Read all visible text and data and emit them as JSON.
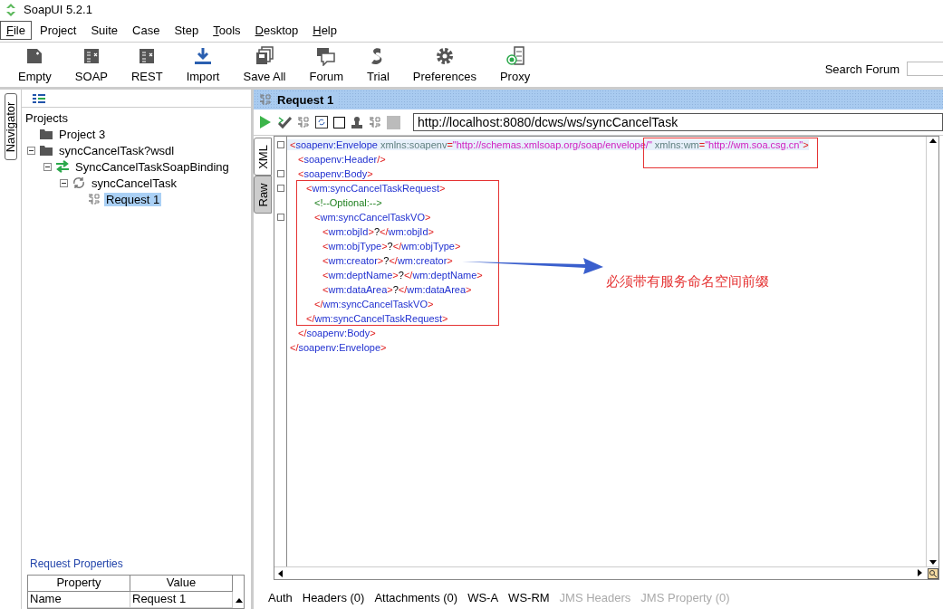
{
  "window": {
    "title": "SoapUI 5.2.1"
  },
  "menu": [
    {
      "label": "File",
      "mnemonic": true,
      "selected": true
    },
    {
      "label": "Project",
      "mnemonic": false,
      "selected": false
    },
    {
      "label": "Suite",
      "mnemonic": false,
      "selected": false
    },
    {
      "label": "Case",
      "mnemonic": false,
      "selected": false
    },
    {
      "label": "Step",
      "mnemonic": false,
      "selected": false
    },
    {
      "label": "Tools",
      "mnemonic": true,
      "selected": false
    },
    {
      "label": "Desktop",
      "mnemonic": true,
      "selected": false
    },
    {
      "label": "Help",
      "mnemonic": true,
      "selected": false
    }
  ],
  "toolbar": [
    {
      "label": "Empty",
      "kind": "empty"
    },
    {
      "label": "SOAP",
      "kind": "soap"
    },
    {
      "label": "REST",
      "kind": "rest"
    },
    {
      "label": "Import",
      "kind": "import"
    },
    {
      "label": "Save All",
      "kind": "save"
    },
    {
      "label": "Forum",
      "kind": "forum"
    },
    {
      "label": "Trial",
      "kind": "trial"
    },
    {
      "label": "Preferences",
      "kind": "prefs"
    },
    {
      "label": "Proxy",
      "kind": "proxy"
    }
  ],
  "search": {
    "label": "Search Forum"
  },
  "navigator": {
    "tab": "Navigator",
    "root": "Projects",
    "tree": [
      {
        "label": "Project 3",
        "kind": "project",
        "selected": false
      },
      {
        "label": "syncCancelTask?wsdl",
        "kind": "project",
        "expanded": true,
        "selected": false,
        "children": [
          {
            "label": "SyncCancelTaskSoapBinding",
            "kind": "binding",
            "expanded": true,
            "selected": false,
            "children": [
              {
                "label": "syncCancelTask",
                "kind": "operation",
                "expanded": true,
                "selected": false,
                "children": [
                  {
                    "label": "Request 1",
                    "kind": "request",
                    "selected": true
                  }
                ]
              }
            ]
          }
        ]
      }
    ]
  },
  "properties": {
    "title": "Request Properties",
    "columns": [
      "Property",
      "Value"
    ],
    "rows": [
      [
        "Name",
        "Request 1"
      ]
    ]
  },
  "request": {
    "title": "Request 1",
    "url": "http://localhost:8080/dcws/ws/syncCancelTask",
    "side_tabs": [
      {
        "label": "XML",
        "selected": true
      },
      {
        "label": "Raw",
        "selected": false
      }
    ],
    "xml": [
      {
        "current": true,
        "tokens": [
          {
            "kind": "punct",
            "text": "<"
          },
          {
            "kind": "tag",
            "text": "soapenv:Envelope"
          },
          {
            "kind": "attr",
            "text": " xmlns:soapenv"
          },
          {
            "kind": "punct",
            "text": "="
          },
          {
            "kind": "value",
            "text": "\"http://schemas.xmlsoap.org/soap/envelope/\""
          },
          {
            "kind": "attr",
            "text": " xmlns:wm"
          },
          {
            "kind": "punct",
            "text": "="
          },
          {
            "kind": "value",
            "text": "\"http://wm.soa.csg.cn\""
          },
          {
            "kind": "punct",
            "text": ">"
          }
        ],
        "children": [
          {
            "current": false,
            "tokens": [
              {
                "kind": "punct",
                "text": "<"
              },
              {
                "kind": "tag",
                "text": "soapenv:Header"
              },
              {
                "kind": "punct",
                "text": "/>"
              }
            ]
          },
          {
            "current": false,
            "tokens": [
              {
                "kind": "punct",
                "text": "<"
              },
              {
                "kind": "tag",
                "text": "soapenv:Body"
              },
              {
                "kind": "punct",
                "text": ">"
              }
            ],
            "children": [
              {
                "current": false,
                "tokens": [
                  {
                    "kind": "punct",
                    "text": "<"
                  },
                  {
                    "kind": "tag",
                    "text": "wm:syncCancelTaskRequest"
                  },
                  {
                    "kind": "punct",
                    "text": ">"
                  }
                ],
                "children": [
                  {
                    "current": false,
                    "tokens": [
                      {
                        "kind": "comment",
                        "text": "<!--Optional:-->"
                      }
                    ]
                  },
                  {
                    "current": false,
                    "tokens": [
                      {
                        "kind": "punct",
                        "text": "<"
                      },
                      {
                        "kind": "tag",
                        "text": "wm:syncCancelTaskVO"
                      },
                      {
                        "kind": "punct",
                        "text": ">"
                      }
                    ],
                    "children": [
                      {
                        "current": false,
                        "tokens": [
                          {
                            "kind": "punct",
                            "text": "<"
                          },
                          {
                            "kind": "tag",
                            "text": "wm:objId"
                          },
                          {
                            "kind": "punct",
                            "text": ">"
                          },
                          {
                            "kind": "text",
                            "text": "?"
                          },
                          {
                            "kind": "punct",
                            "text": "</"
                          },
                          {
                            "kind": "tag",
                            "text": "wm:objId"
                          },
                          {
                            "kind": "punct",
                            "text": ">"
                          }
                        ]
                      },
                      {
                        "current": false,
                        "tokens": [
                          {
                            "kind": "punct",
                            "text": "<"
                          },
                          {
                            "kind": "tag",
                            "text": "wm:objType"
                          },
                          {
                            "kind": "punct",
                            "text": ">"
                          },
                          {
                            "kind": "text",
                            "text": "?"
                          },
                          {
                            "kind": "punct",
                            "text": "</"
                          },
                          {
                            "kind": "tag",
                            "text": "wm:objType"
                          },
                          {
                            "kind": "punct",
                            "text": ">"
                          }
                        ]
                      },
                      {
                        "current": false,
                        "tokens": [
                          {
                            "kind": "punct",
                            "text": "<"
                          },
                          {
                            "kind": "tag",
                            "text": "wm:creator"
                          },
                          {
                            "kind": "punct",
                            "text": ">"
                          },
                          {
                            "kind": "text",
                            "text": "?"
                          },
                          {
                            "kind": "punct",
                            "text": "</"
                          },
                          {
                            "kind": "tag",
                            "text": "wm:creator"
                          },
                          {
                            "kind": "punct",
                            "text": ">"
                          }
                        ]
                      },
                      {
                        "current": false,
                        "tokens": [
                          {
                            "kind": "punct",
                            "text": "<"
                          },
                          {
                            "kind": "tag",
                            "text": "wm:deptName"
                          },
                          {
                            "kind": "punct",
                            "text": ">"
                          },
                          {
                            "kind": "text",
                            "text": "?"
                          },
                          {
                            "kind": "punct",
                            "text": "</"
                          },
                          {
                            "kind": "tag",
                            "text": "wm:deptName"
                          },
                          {
                            "kind": "punct",
                            "text": ">"
                          }
                        ]
                      },
                      {
                        "current": false,
                        "tokens": [
                          {
                            "kind": "punct",
                            "text": "<"
                          },
                          {
                            "kind": "tag",
                            "text": "wm:dataArea"
                          },
                          {
                            "kind": "punct",
                            "text": ">"
                          },
                          {
                            "kind": "text",
                            "text": "?"
                          },
                          {
                            "kind": "punct",
                            "text": "</"
                          },
                          {
                            "kind": "tag",
                            "text": "wm:dataArea"
                          },
                          {
                            "kind": "punct",
                            "text": ">"
                          }
                        ]
                      }
                    ]
                  },
                  {
                    "current": false,
                    "tokens": [
                      {
                        "kind": "punct",
                        "text": "</"
                      },
                      {
                        "kind": "tag",
                        "text": "wm:syncCancelTaskVO"
                      },
                      {
                        "kind": "punct",
                        "text": ">"
                      }
                    ]
                  }
                ]
              },
              {
                "current": false,
                "tokens": [
                  {
                    "kind": "punct",
                    "text": "</"
                  },
                  {
                    "kind": "tag",
                    "text": "wm:syncCancelTaskRequest"
                  },
                  {
                    "kind": "punct",
                    "text": ">"
                  }
                ]
              }
            ]
          },
          {
            "current": false,
            "tokens": [
              {
                "kind": "punct",
                "text": "</"
              },
              {
                "kind": "tag",
                "text": "soapenv:Body"
              },
              {
                "kind": "punct",
                "text": ">"
              }
            ]
          }
        ]
      },
      {
        "current": false,
        "tokens": [
          {
            "kind": "punct",
            "text": "</"
          },
          {
            "kind": "tag",
            "text": "soapenv:Envelope"
          },
          {
            "kind": "punct",
            "text": ">"
          }
        ]
      }
    ],
    "annotation": "必须带有服务命名空间前缀",
    "bottom_tabs": [
      {
        "label": "Auth",
        "disabled": false
      },
      {
        "label": "Headers (0)",
        "disabled": false
      },
      {
        "label": "Attachments (0)",
        "disabled": false
      },
      {
        "label": "WS-A",
        "disabled": false
      },
      {
        "label": "WS-RM",
        "disabled": false
      },
      {
        "label": "JMS Headers",
        "disabled": true
      },
      {
        "label": "JMS Property (0)",
        "disabled": true
      }
    ]
  }
}
